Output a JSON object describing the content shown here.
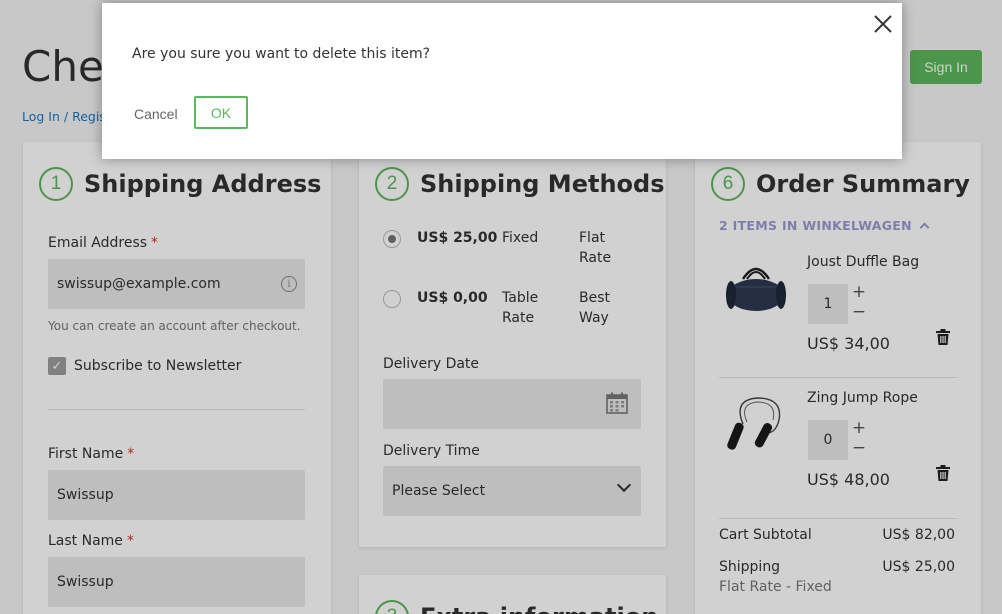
{
  "header": {
    "title": "Checkout",
    "login_link": "Log In / Register",
    "sign_in_label": "Sign In"
  },
  "shipping_address": {
    "step_number": "1",
    "title": "Shipping Address",
    "email_label": "Email Address",
    "email_value": "swissup@example.com",
    "email_hint": "You can create an account after checkout.",
    "newsletter_label": "Subscribe to Newsletter",
    "newsletter_checked": true,
    "first_name_label": "First Name",
    "first_name_value": "Swissup",
    "last_name_label": "Last Name",
    "last_name_value": "Swissup",
    "required_mark": "*"
  },
  "shipping_methods": {
    "step_number": "2",
    "title": "Shipping Methods",
    "methods": [
      {
        "price": "US$ 25,00",
        "method": "Fixed",
        "carrier": "Flat Rate",
        "selected": true
      },
      {
        "price": "US$ 0,00",
        "method": "Table Rate",
        "carrier": "Best Way",
        "selected": false
      }
    ],
    "delivery_date_label": "Delivery Date",
    "delivery_time_label": "Delivery Time",
    "delivery_time_value": "Please Select"
  },
  "extra_info": {
    "step_number": "3",
    "title": "Extra information"
  },
  "order_summary": {
    "step_number": "6",
    "title": "Order Summary",
    "items_toggle": "2 ITEMS IN WINKELWAGEN",
    "items": [
      {
        "name": "Joust Duffle Bag",
        "qty": "1",
        "price": "US$ 34,00",
        "icon": "duffle-bag"
      },
      {
        "name": "Zing Jump Rope",
        "qty": "0",
        "price": "US$ 48,00",
        "icon": "jump-rope"
      }
    ],
    "subtotal_label": "Cart Subtotal",
    "subtotal_value": "US$ 82,00",
    "shipping_label": "Shipping",
    "shipping_value": "US$ 25,00",
    "shipping_method": "Flat Rate - Fixed"
  },
  "modal": {
    "message": "Are you sure you want to delete this item?",
    "cancel_label": "Cancel",
    "ok_label": "OK"
  },
  "colors": {
    "accent": "#5cb85c",
    "link": "#1979c3",
    "required": "#e02b27"
  }
}
